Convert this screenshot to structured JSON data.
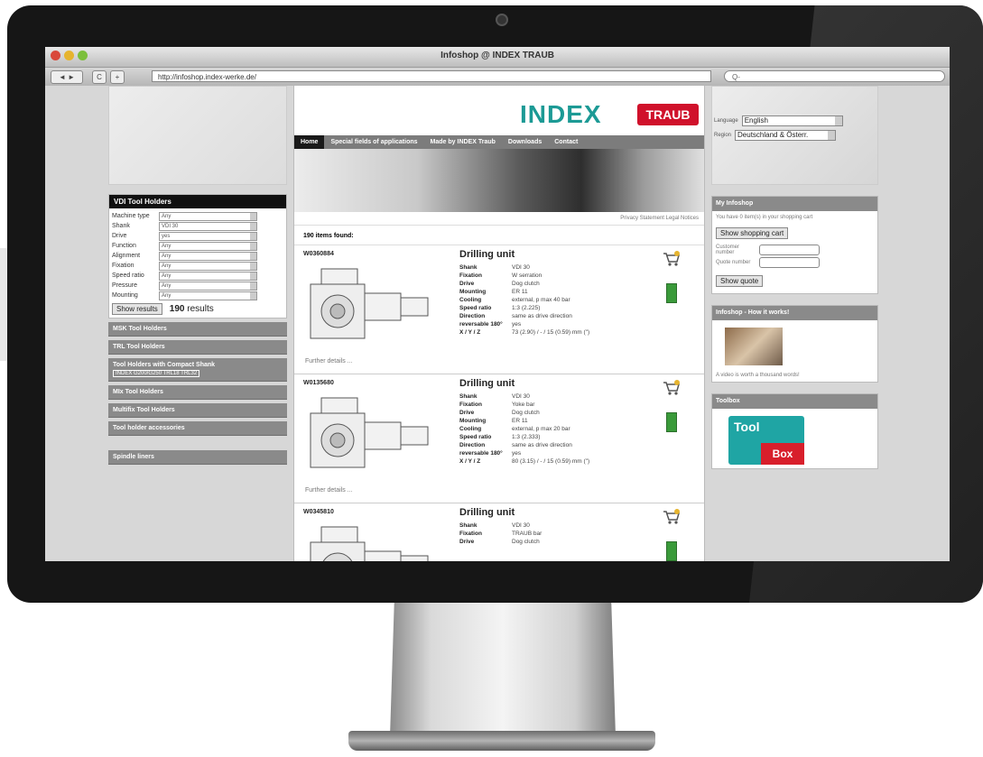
{
  "window": {
    "title": "Infoshop @ INDEX TRAUB"
  },
  "browser": {
    "back": "◄ ►",
    "reload": "C",
    "add": "+",
    "url": "http://infoshop.index-werke.de/",
    "search_placeholder": "Q-"
  },
  "brand": {
    "index": "INDEX",
    "traub": "TRAUB"
  },
  "nav": {
    "items": [
      "Home",
      "Special fields of applications",
      "Made by INDEX Traub",
      "Downloads",
      "Contact"
    ]
  },
  "legal": "Privacy Statement   Legal Notices",
  "filters": {
    "title": "VDI Tool Holders",
    "rows": [
      {
        "label": "Machine type",
        "value": "Any"
      },
      {
        "label": "Shank",
        "value": "VDI 30"
      },
      {
        "label": "Drive",
        "value": "yes"
      },
      {
        "label": "Function",
        "value": "Any"
      },
      {
        "label": "Alignment",
        "value": "Any"
      },
      {
        "label": "Fixation",
        "value": "Any"
      },
      {
        "label": "Speed ratio",
        "value": "Any"
      },
      {
        "label": "Pressure",
        "value": "Any"
      },
      {
        "label": "Mounting",
        "value": "Any"
      }
    ],
    "show_button": "Show results",
    "count_num": "190",
    "count_text": "results"
  },
  "categories": [
    "MSK Tool Holders",
    "TRL Tool Holders",
    "Tool Holders with Compact Shank",
    "MIx Tool Holders",
    "Multifix Tool Holders",
    "Tool holder accessories",
    "Spindle liners"
  ],
  "compact_tag": "INDEX G200/G250 TRL18 TRL32",
  "results": {
    "found": "190 items found:"
  },
  "products": [
    {
      "code": "W0360884",
      "title": "Drilling unit",
      "details": "Further details ...",
      "specs": [
        [
          "Shank",
          "VDI 30"
        ],
        [
          "Fixation",
          "W serration"
        ],
        [
          "Drive",
          "Dog clutch"
        ],
        [
          "Mounting",
          "ER 11"
        ],
        [
          "Cooling",
          "external, p max 40 bar"
        ],
        [
          "Speed ratio",
          "1:3 (2.225)"
        ],
        [
          "Direction",
          "same as drive direction"
        ],
        [
          "reversable 180°",
          "yes"
        ],
        [
          "X / Y / Z",
          "73 (2.90) / - / 15 (0.59) mm (\")"
        ]
      ]
    },
    {
      "code": "W0135680",
      "title": "Drilling unit",
      "details": "Further details ...",
      "specs": [
        [
          "Shank",
          "VDI 30"
        ],
        [
          "Fixation",
          "Yoke bar"
        ],
        [
          "Drive",
          "Dog clutch"
        ],
        [
          "Mounting",
          "ER 11"
        ],
        [
          "Cooling",
          "external, p max 20 bar"
        ],
        [
          "Speed ratio",
          "1:3 (2.333)"
        ],
        [
          "Direction",
          "same as drive direction"
        ],
        [
          "reversable 180°",
          "yes"
        ],
        [
          "X / Y / Z",
          "80 (3.15) / - / 15 (0.59) mm (\")"
        ]
      ]
    },
    {
      "code": "W0345810",
      "title": "Drilling unit",
      "details": "",
      "specs": [
        [
          "Shank",
          "VDI 30"
        ],
        [
          "Fixation",
          "TRAUB bar"
        ],
        [
          "Drive",
          "Dog clutch"
        ]
      ]
    }
  ],
  "language": {
    "label_language": "Language",
    "value_language": "English",
    "label_region": "Region",
    "value_region": "Deutschland & Österr."
  },
  "infoshop": {
    "title": "My Infoshop",
    "cart_text": "You have 0 item(s) in your shopping cart",
    "cart_button": "Show shopping cart",
    "customer_label": "Customer number",
    "quote_label": "Quote number",
    "quote_button": "Show quote"
  },
  "how": {
    "title": "Infoshop - How it works!",
    "caption": "A video is worth a thousand words!"
  },
  "toolbox": {
    "title": "Toolbox",
    "word1": "Tool",
    "word2": "Box"
  }
}
